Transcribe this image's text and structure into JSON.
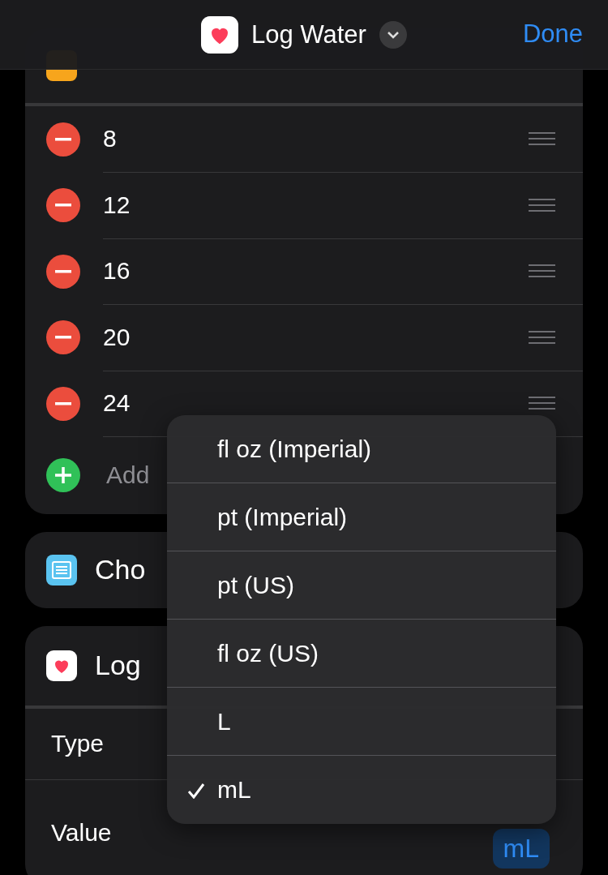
{
  "header": {
    "title": "Log Water",
    "done": "Done"
  },
  "list_card": {
    "items": [
      {
        "value": "8"
      },
      {
        "value": "12"
      },
      {
        "value": "16"
      },
      {
        "value": "20"
      },
      {
        "value": "24"
      }
    ],
    "add_placeholder": "Add"
  },
  "choose_card": {
    "title": "Cho"
  },
  "health_card": {
    "title": "Log",
    "fields": [
      {
        "label": "Type"
      },
      {
        "label": "Value",
        "unit": "mL"
      }
    ]
  },
  "menu": {
    "items": [
      {
        "label": "fl oz (Imperial)",
        "selected": false
      },
      {
        "label": "pt (Imperial)",
        "selected": false
      },
      {
        "label": "pt (US)",
        "selected": false
      },
      {
        "label": "fl oz (US)",
        "selected": false
      },
      {
        "label": "L",
        "selected": false
      },
      {
        "label": "mL",
        "selected": true
      }
    ]
  }
}
